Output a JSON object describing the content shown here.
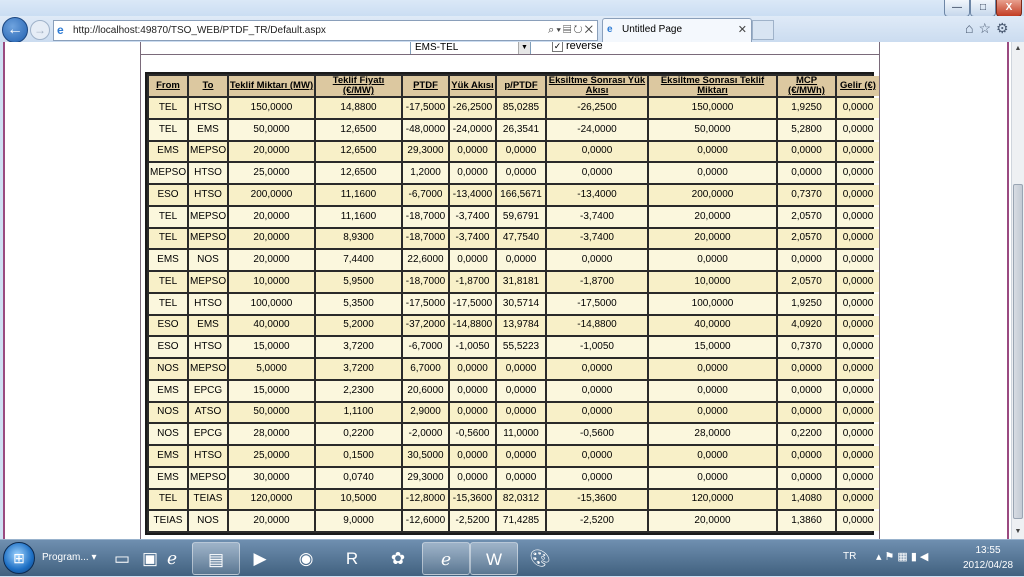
{
  "browser": {
    "url": "http://localhost:49870/TSO_WEB/PTDF_TR/Default.aspx",
    "tab_title": "Untitled Page",
    "window_buttons": {
      "minimize": "—",
      "maximize": "□",
      "close": "X"
    }
  },
  "controls": {
    "dropdown_value": "EMS-TEL",
    "reverse_label": "reverse",
    "reverse_checked": true
  },
  "table": {
    "headers": [
      "From",
      "To",
      "Teklif Miktarı (MW)",
      "Teklif Fiyatı (€/MW)",
      "PTDF",
      "Yük Akısı",
      "p/PTDF",
      "Eksiltme Sonrası Yük Akısı",
      "Eksiltme Sonrası Teklif Miktarı",
      "MCP (€/MWh)",
      "Gelir (€)"
    ],
    "rows": [
      [
        "TEL",
        "HTSO",
        "150,0000",
        "14,8800",
        "-17,5000",
        "-26,2500",
        "85,0285",
        "-26,2500",
        "150,0000",
        "1,9250",
        "0,0000"
      ],
      [
        "TEL",
        "EMS",
        "50,0000",
        "12,6500",
        "-48,0000",
        "-24,0000",
        "26,3541",
        "-24,0000",
        "50,0000",
        "5,2800",
        "0,0000"
      ],
      [
        "EMS",
        "MEPSO",
        "20,0000",
        "12,6500",
        "29,3000",
        "0,0000",
        "0,0000",
        "0,0000",
        "0,0000",
        "0,0000",
        "0,0000"
      ],
      [
        "MEPSO",
        "HTSO",
        "25,0000",
        "12,6500",
        "1,2000",
        "0,0000",
        "0,0000",
        "0,0000",
        "0,0000",
        "0,0000",
        "0,0000"
      ],
      [
        "ESO",
        "HTSO",
        "200,0000",
        "11,1600",
        "-6,7000",
        "-13,4000",
        "166,5671",
        "-13,4000",
        "200,0000",
        "0,7370",
        "0,0000"
      ],
      [
        "TEL",
        "MEPSO",
        "20,0000",
        "11,1600",
        "-18,7000",
        "-3,7400",
        "59,6791",
        "-3,7400",
        "20,0000",
        "2,0570",
        "0,0000"
      ],
      [
        "TEL",
        "MEPSO",
        "20,0000",
        "8,9300",
        "-18,7000",
        "-3,7400",
        "47,7540",
        "-3,7400",
        "20,0000",
        "2,0570",
        "0,0000"
      ],
      [
        "EMS",
        "NOS",
        "20,0000",
        "7,4400",
        "22,6000",
        "0,0000",
        "0,0000",
        "0,0000",
        "0,0000",
        "0,0000",
        "0,0000"
      ],
      [
        "TEL",
        "MEPSO",
        "10,0000",
        "5,9500",
        "-18,7000",
        "-1,8700",
        "31,8181",
        "-1,8700",
        "10,0000",
        "2,0570",
        "0,0000"
      ],
      [
        "TEL",
        "HTSO",
        "100,0000",
        "5,3500",
        "-17,5000",
        "-17,5000",
        "30,5714",
        "-17,5000",
        "100,0000",
        "1,9250",
        "0,0000"
      ],
      [
        "ESO",
        "EMS",
        "40,0000",
        "5,2000",
        "-37,2000",
        "-14,8800",
        "13,9784",
        "-14,8800",
        "40,0000",
        "4,0920",
        "0,0000"
      ],
      [
        "ESO",
        "HTSO",
        "15,0000",
        "3,7200",
        "-6,7000",
        "-1,0050",
        "55,5223",
        "-1,0050",
        "15,0000",
        "0,7370",
        "0,0000"
      ],
      [
        "NOS",
        "MEPSO",
        "5,0000",
        "3,7200",
        "6,7000",
        "0,0000",
        "0,0000",
        "0,0000",
        "0,0000",
        "0,0000",
        "0,0000"
      ],
      [
        "EMS",
        "EPCG",
        "15,0000",
        "2,2300",
        "20,6000",
        "0,0000",
        "0,0000",
        "0,0000",
        "0,0000",
        "0,0000",
        "0,0000"
      ],
      [
        "NOS",
        "ATSO",
        "50,0000",
        "1,1100",
        "2,9000",
        "0,0000",
        "0,0000",
        "0,0000",
        "0,0000",
        "0,0000",
        "0,0000"
      ],
      [
        "NOS",
        "EPCG",
        "28,0000",
        "0,2200",
        "-2,0000",
        "-0,5600",
        "11,0000",
        "-0,5600",
        "28,0000",
        "0,2200",
        "0,0000"
      ],
      [
        "EMS",
        "HTSO",
        "25,0000",
        "0,1500",
        "30,5000",
        "0,0000",
        "0,0000",
        "0,0000",
        "0,0000",
        "0,0000",
        "0,0000"
      ],
      [
        "EMS",
        "MEPSO",
        "30,0000",
        "0,0740",
        "29,3000",
        "0,0000",
        "0,0000",
        "0,0000",
        "0,0000",
        "0,0000",
        "0,0000"
      ],
      [
        "TEL",
        "TEIAS",
        "120,0000",
        "10,5000",
        "-12,8000",
        "-15,3600",
        "82,0312",
        "-15,3600",
        "120,0000",
        "1,4080",
        "0,0000"
      ],
      [
        "TEIAS",
        "NOS",
        "20,0000",
        "9,0000",
        "-12,6000",
        "-2,5200",
        "71,4285",
        "-2,5200",
        "20,0000",
        "1,3860",
        "0,0000"
      ]
    ]
  },
  "taskbar": {
    "program_label": "Program...",
    "apps": [
      "show-desktop",
      "taskmgr",
      "internet-explorer",
      "file-explorer",
      "media-player",
      "firefox",
      "rekall",
      "paint-app",
      "internet-explorer",
      "word",
      "paint-palette"
    ],
    "lang": "TR",
    "time": "13:55",
    "date": "2012/04/28"
  },
  "colors": {
    "header_bg": "#dcc8a0",
    "row_a": "#f8f0c8",
    "row_b": "#fbf7dd",
    "frame": "#9a4a80"
  }
}
